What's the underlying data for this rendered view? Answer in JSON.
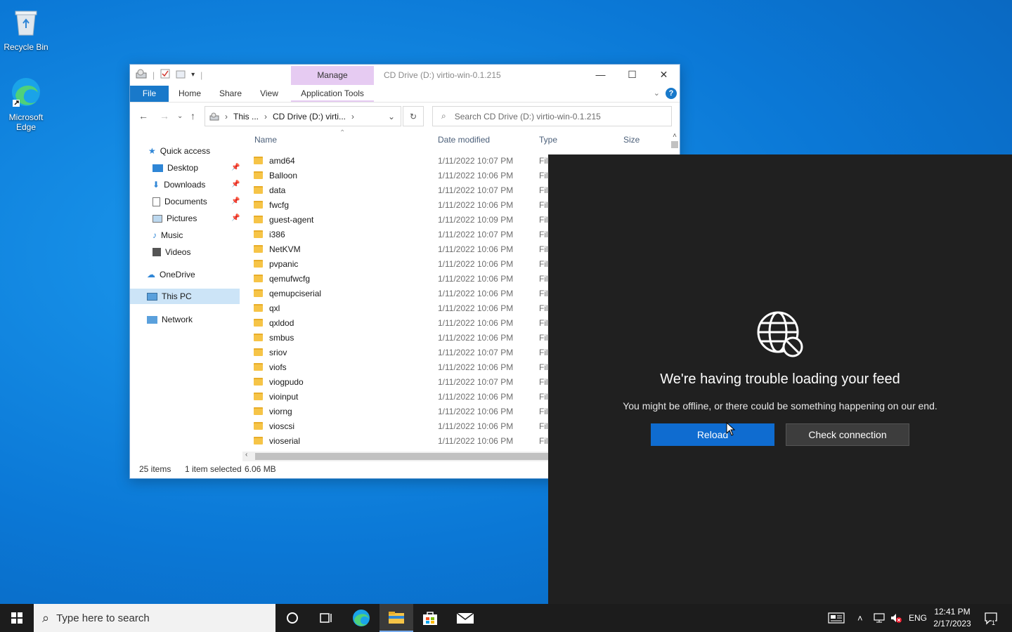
{
  "desktop": {
    "recycle_bin": "Recycle Bin",
    "edge_line1": "Microsoft",
    "edge_line2": "Edge"
  },
  "explorer": {
    "ribbon_manage": "Manage",
    "title": "CD Drive (D:) virtio-win-0.1.215",
    "tabs": [
      "File",
      "Home",
      "Share",
      "View",
      "Application Tools"
    ],
    "address_parts": [
      "This ...",
      "CD Drive (D:) virti..."
    ],
    "search_placeholder": "Search CD Drive (D:) virtio-win-0.1.215",
    "nav": {
      "quick_access": "Quick access",
      "desktop": "Desktop",
      "downloads": "Downloads",
      "documents": "Documents",
      "pictures": "Pictures",
      "music": "Music",
      "videos": "Videos",
      "onedrive": "OneDrive",
      "this_pc": "This PC",
      "network": "Network"
    },
    "columns": {
      "name": "Name",
      "date": "Date modified",
      "type": "Type",
      "size": "Size"
    },
    "files": [
      {
        "name": "amd64",
        "date": "1/11/2022 10:07 PM",
        "type": "Fil"
      },
      {
        "name": "Balloon",
        "date": "1/11/2022 10:06 PM",
        "type": "Fil"
      },
      {
        "name": "data",
        "date": "1/11/2022 10:07 PM",
        "type": "Fil"
      },
      {
        "name": "fwcfg",
        "date": "1/11/2022 10:06 PM",
        "type": "Fil"
      },
      {
        "name": "guest-agent",
        "date": "1/11/2022 10:09 PM",
        "type": "Fil"
      },
      {
        "name": "i386",
        "date": "1/11/2022 10:07 PM",
        "type": "Fil"
      },
      {
        "name": "NetKVM",
        "date": "1/11/2022 10:06 PM",
        "type": "Fil"
      },
      {
        "name": "pvpanic",
        "date": "1/11/2022 10:06 PM",
        "type": "Fil"
      },
      {
        "name": "qemufwcfg",
        "date": "1/11/2022 10:06 PM",
        "type": "Fil"
      },
      {
        "name": "qemupciserial",
        "date": "1/11/2022 10:06 PM",
        "type": "Fil"
      },
      {
        "name": "qxl",
        "date": "1/11/2022 10:06 PM",
        "type": "Fil"
      },
      {
        "name": "qxldod",
        "date": "1/11/2022 10:06 PM",
        "type": "Fil"
      },
      {
        "name": "smbus",
        "date": "1/11/2022 10:06 PM",
        "type": "Fil"
      },
      {
        "name": "sriov",
        "date": "1/11/2022 10:07 PM",
        "type": "Fil"
      },
      {
        "name": "viofs",
        "date": "1/11/2022 10:06 PM",
        "type": "Fil"
      },
      {
        "name": "viogpudo",
        "date": "1/11/2022 10:07 PM",
        "type": "Fil"
      },
      {
        "name": "vioinput",
        "date": "1/11/2022 10:06 PM",
        "type": "Fil"
      },
      {
        "name": "viorng",
        "date": "1/11/2022 10:06 PM",
        "type": "Fil"
      },
      {
        "name": "vioscsi",
        "date": "1/11/2022 10:06 PM",
        "type": "Fil"
      },
      {
        "name": "vioserial",
        "date": "1/11/2022 10:06 PM",
        "type": "Fil"
      }
    ],
    "status": {
      "items": "25 items",
      "selected": "1 item selected",
      "size": "6.06 MB"
    }
  },
  "feed": {
    "headline": "We're having trouble loading your feed",
    "sub": "You might be offline, or there could be something happening on our end.",
    "reload": "Reload",
    "check": "Check connection"
  },
  "taskbar": {
    "search_placeholder": "Type here to search",
    "lang": "ENG",
    "time": "12:41 PM",
    "date": "2/17/2023",
    "notif_count": "1"
  },
  "colors": {
    "accent": "#0f6cd0",
    "file_tab": "#1979ca",
    "manage_tab": "#e6cbf2",
    "feed_bg": "#202020"
  }
}
